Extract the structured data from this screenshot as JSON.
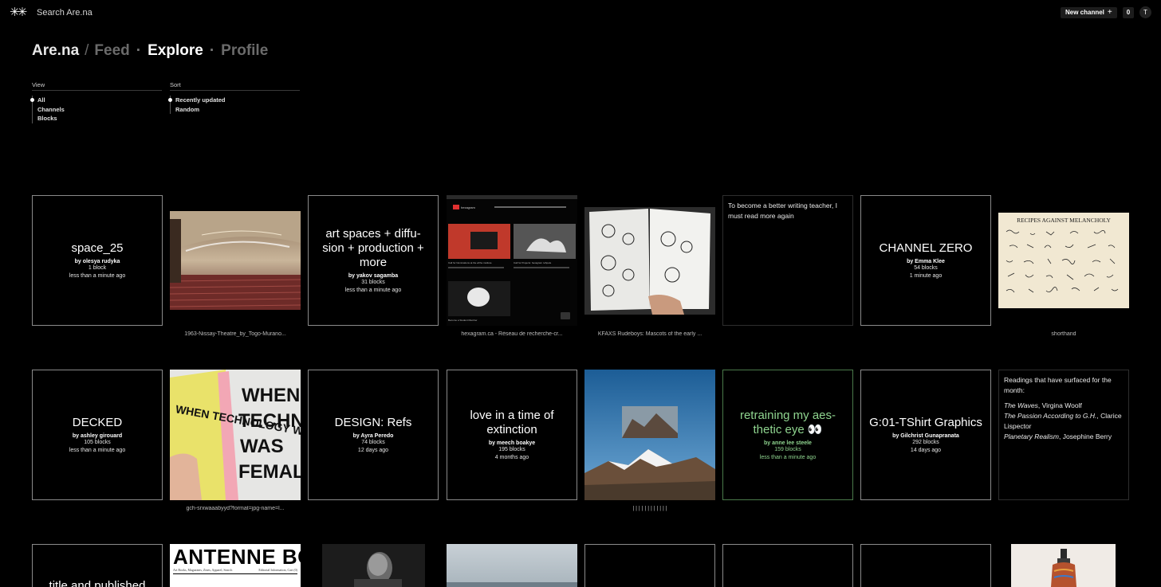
{
  "topbar": {
    "logo": "✳✳",
    "search_placeholder": "Search Are.na",
    "new_channel_label": "New channel",
    "new_channel_plus": "+",
    "notification_count": "0",
    "avatar_initial": "T"
  },
  "nav": {
    "brand": "Are.na",
    "separator": "/",
    "items": [
      "Feed",
      "Explore",
      "Profile"
    ],
    "active": "Explore"
  },
  "filters": {
    "view": {
      "label": "View",
      "options": [
        "All",
        "Channels",
        "Blocks"
      ],
      "selected": "All"
    },
    "sort": {
      "label": "Sort",
      "options": [
        "Recently updated",
        "Random"
      ],
      "selected": "Recently updated"
    }
  },
  "row1": {
    "space25": {
      "title": "space_25",
      "by": "by olesya rudyka",
      "blocks": "1 block",
      "time": "less than a minute ago"
    },
    "nissay_caption": "1963-Nissay-Theatre_by_Togo-Murano...",
    "artspaces": {
      "title": "art spaces + diffu-sion + production + more",
      "by": "by yakov sagamba",
      "blocks": "31 blocks",
      "time": "less than a minute ago"
    },
    "hexagram_caption": "hexagram.ca - Réseau de recherche-cr...",
    "hexagram_screen": {
      "site": "hexagram",
      "card1": "Call for Nominations at the whhe institute",
      "card2": "Call for Projects: hexagram reSpole",
      "card3": "Become a Student Member"
    },
    "kfaxs_caption": "KFAXS Rudeboys: Mascots of the early ...",
    "writing_text": "To become a better writing teacher, I must read more again",
    "channelzero": {
      "title": "CHANNEL ZERO",
      "by": "by Emma Klee",
      "blocks": "54 blocks",
      "time": "1 minute ago"
    },
    "recipes_title": "RECIPES AGAINST MELANCHOLY",
    "shorthand_caption": "shorthand"
  },
  "row2": {
    "decked": {
      "title": "DECKED",
      "by": "by ashley girouard",
      "blocks": "105 blocks",
      "time": "less than a minute ago"
    },
    "poster_caption": "gch-srxwaaabyyd?format=jpg-name=l...",
    "poster_text": "WHEN TECHNOLOGY WAS FEMALE",
    "design": {
      "title": "DESIGN: Refs",
      "by": "by Ayra Peredo",
      "blocks": "74 blocks",
      "time": "12 days ago"
    },
    "love": {
      "title": "love in a time of extinction",
      "by": "by meech boakye",
      "blocks": "195 blocks",
      "time": "4 months ago"
    },
    "mountain_caption": "| | | | | | | | | | | |",
    "retraining": {
      "title": "retraining my aes-thetic eye 👀",
      "by": "by anne lee steele",
      "blocks": "159 blocks",
      "time": "less than a minute ago"
    },
    "tshirt": {
      "title": "G:01-TShirt Graphics",
      "by": "by Gilchrist Gunapranata",
      "blocks": "292 blocks",
      "time": "14 days ago"
    },
    "readings": {
      "intro": "Readings that have surfaced for the month:",
      "items": [
        {
          "title": "The Waves",
          "author": ", Virgina Woolf"
        },
        {
          "title": "The Passion According to G.H.",
          "author": ", Clarice Lispector"
        },
        {
          "title": "Planetary Realism",
          "author": ", Josephine Berry"
        }
      ]
    }
  },
  "row3": {
    "partial_title": "title and published",
    "antenne_title": "ANTENNE BOOKS",
    "antenne_sub": "Art Books, Magazines, Zines, Apparel, Search",
    "antenne_sub2": "Editorial Information, Cart (0)"
  },
  "colors": {
    "background": "#000000",
    "card_border": "#8a8a8a",
    "green_accent": "#8fd48f",
    "muted_nav": "#6b6b6b"
  }
}
